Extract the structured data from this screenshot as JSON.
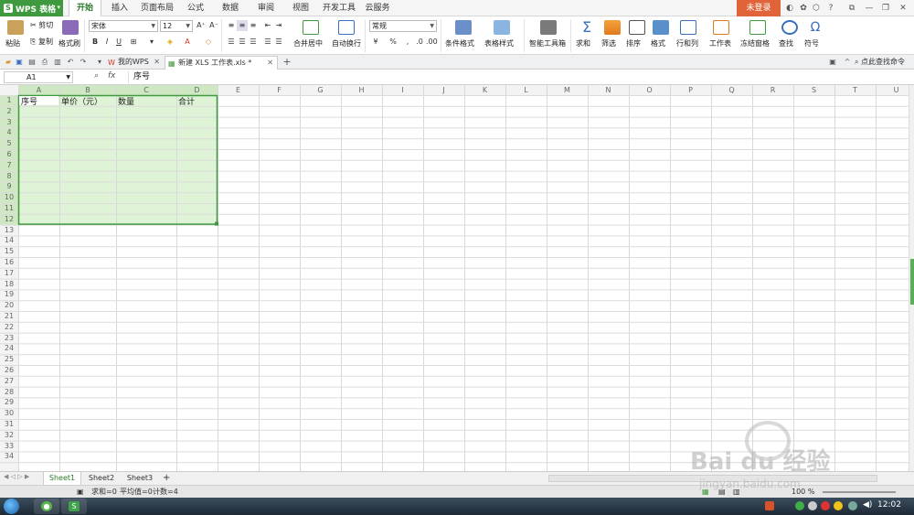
{
  "app": {
    "name": "WPS 表格"
  },
  "menu": {
    "tabs": [
      "开始",
      "插入",
      "页面布局",
      "公式",
      "数据",
      "审阅",
      "视图",
      "开发工具",
      "云服务"
    ],
    "active": "开始",
    "login": "未登录"
  },
  "ribbon": {
    "paste": "粘贴",
    "cut": "剪切",
    "copy": "复制",
    "format_painter": "格式刷",
    "font_name": "宋体",
    "font_size": "12",
    "bold": "B",
    "italic": "I",
    "underline": "U",
    "merge_center": "合并居中",
    "wrap_text": "自动换行",
    "number_format": "常规",
    "percent": "%",
    "conditional_format": "条件格式",
    "table_style": "表格样式",
    "smart_toolbox": "智能工具箱",
    "sum": "求和",
    "filter": "筛选",
    "sort": "排序",
    "format": "格式",
    "row_col": "行和列",
    "worksheet": "工作表",
    "freeze": "冻结窗格",
    "find": "查找",
    "symbol": "符号"
  },
  "tabs_bar": {
    "my_wps": "我的WPS",
    "document": "新建 XLS 工作表.xls *",
    "search_cmd": "点此查找命令"
  },
  "formula_bar": {
    "cell_ref": "A1",
    "fx": "fx",
    "value": "序号"
  },
  "sheet": {
    "columns": [
      "A",
      "B",
      "C",
      "D",
      "E",
      "F",
      "G",
      "H",
      "I",
      "J",
      "K",
      "L",
      "M",
      "N",
      "O",
      "P",
      "Q",
      "R",
      "S",
      "T",
      "U"
    ],
    "rows": [
      "1",
      "2",
      "3",
      "4",
      "5",
      "6",
      "7",
      "8",
      "9",
      "10",
      "11",
      "12",
      "13",
      "14",
      "15",
      "16",
      "17",
      "18",
      "19",
      "20",
      "21",
      "22",
      "23",
      "24",
      "25",
      "26",
      "27",
      "28",
      "29",
      "30",
      "31",
      "32",
      "33",
      "34"
    ],
    "headers": [
      "序号",
      "单价（元）",
      "数量",
      "合计"
    ]
  },
  "sheet_tabs": [
    "Sheet1",
    "Sheet2",
    "Sheet3"
  ],
  "status": {
    "sum": "求和=0",
    "average": "平均值=0",
    "count": "计数=4",
    "zoom": "100 %"
  },
  "taskbar": {
    "clock": "12:02"
  },
  "watermark": {
    "text": "Bai du 经验",
    "url": "jingyan.baidu.com"
  },
  "colors": {
    "accent": "#3f9a3f",
    "selection": "#dff3d6",
    "login": "#e0633a"
  }
}
